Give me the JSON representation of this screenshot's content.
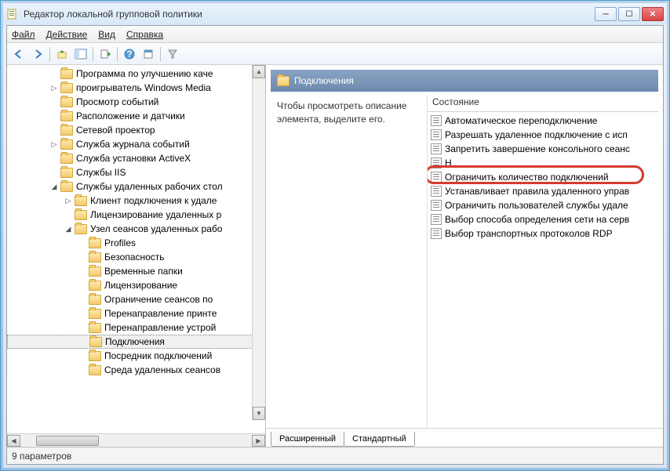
{
  "window": {
    "title": "Редактор локальной групповой политики"
  },
  "menu": {
    "file": "Файл",
    "action": "Действие",
    "view": "Вид",
    "help": "Справка"
  },
  "tree": {
    "items": [
      {
        "indent": 3,
        "label": "Программа по улучшению каче",
        "expander": ""
      },
      {
        "indent": 3,
        "label": "проигрыватель Windows Media",
        "expander": "▷"
      },
      {
        "indent": 3,
        "label": "Просмотр событий",
        "expander": ""
      },
      {
        "indent": 3,
        "label": "Расположение и датчики",
        "expander": ""
      },
      {
        "indent": 3,
        "label": "Сетевой проектор",
        "expander": ""
      },
      {
        "indent": 3,
        "label": "Служба журнала событий",
        "expander": "▷"
      },
      {
        "indent": 3,
        "label": "Служба установки ActiveX",
        "expander": ""
      },
      {
        "indent": 3,
        "label": "Службы IIS",
        "expander": ""
      },
      {
        "indent": 3,
        "label": "Службы удаленных рабочих стол",
        "expander": "◢"
      },
      {
        "indent": 4,
        "label": "Клиент подключения к удале",
        "expander": "▷"
      },
      {
        "indent": 4,
        "label": "Лицензирование удаленных р",
        "expander": ""
      },
      {
        "indent": 4,
        "label": "Узел сеансов удаленных рабо",
        "expander": "◢"
      },
      {
        "indent": 5,
        "label": "Profiles",
        "expander": ""
      },
      {
        "indent": 5,
        "label": "Безопасность",
        "expander": ""
      },
      {
        "indent": 5,
        "label": "Временные папки",
        "expander": ""
      },
      {
        "indent": 5,
        "label": "Лицензирование",
        "expander": ""
      },
      {
        "indent": 5,
        "label": "Ограничение сеансов по",
        "expander": ""
      },
      {
        "indent": 5,
        "label": "Перенаправление принте",
        "expander": ""
      },
      {
        "indent": 5,
        "label": "Перенаправление устрой",
        "expander": ""
      },
      {
        "indent": 5,
        "label": "Подключения",
        "expander": "",
        "selected": true
      },
      {
        "indent": 5,
        "label": "Посредник подключений",
        "expander": ""
      },
      {
        "indent": 5,
        "label": "Среда удаленных сеансов",
        "expander": ""
      }
    ]
  },
  "right": {
    "header": "Подключения",
    "description": "Чтобы просмотреть описание элемента, выделите его.",
    "column_header": "Состояние",
    "items": [
      "Автоматическое переподключение",
      "Разрешать удаленное подключение с исп",
      "Запретить завершение консольного сеанс",
      "Н",
      "Ограничить количество подключений",
      "Устанавливает правила удаленного управ",
      "Ограничить пользователей службы удале",
      "Выбор способа определения сети на серв",
      "Выбор транспортных протоколов RDP"
    ],
    "highlighted_index": 4
  },
  "tabs": {
    "extended": "Расширенный",
    "standard": "Стандартный"
  },
  "statusbar": {
    "text": "9 параметров"
  }
}
